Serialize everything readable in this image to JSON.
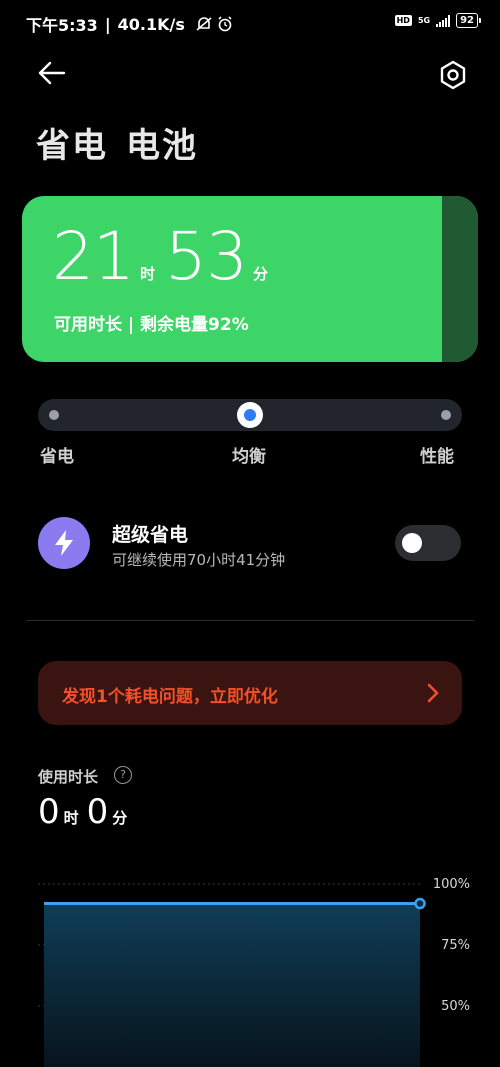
{
  "status_bar": {
    "time": "下午5:33",
    "net_speed": "40.1K/s",
    "hd": "HD",
    "network": "5G",
    "battery": "92"
  },
  "header": {
    "back_icon": "arrow-left-icon",
    "settings_icon": "gear-hexagon-icon",
    "title_part1": "省电",
    "title_part2": "电池"
  },
  "battery_card": {
    "hours": "21",
    "hours_unit": "时",
    "minutes": "53",
    "minutes_unit": "分",
    "subtitle": "可用时长 | 剩余电量92%",
    "level_fraction": 0.92,
    "color_fill": "#3dd468",
    "color_empty": "#1f5a33"
  },
  "mode_slider": {
    "options": [
      "省电",
      "均衡",
      "性能"
    ],
    "selected_index": 1
  },
  "super_saver": {
    "icon": "lightning-bolt-icon",
    "title": "超级省电",
    "subtitle": "可继续使用70小时41分钟",
    "enabled": false
  },
  "issue_banner": {
    "text": "发现1个耗电问题，立即优化",
    "icon": "chevron-right-icon",
    "color": "#f4502b"
  },
  "usage": {
    "label": "使用时长",
    "help_icon": "question-circle-icon",
    "hours": "0",
    "hours_unit": "时",
    "minutes": "0",
    "minutes_unit": "分"
  },
  "chart_data": {
    "type": "area",
    "y_tick_labels": [
      "100%",
      "75%",
      "50%"
    ],
    "ylim": [
      50,
      100
    ],
    "series": [
      {
        "values": [
          92,
          92
        ]
      }
    ],
    "line_color": "#3ea0f0"
  }
}
